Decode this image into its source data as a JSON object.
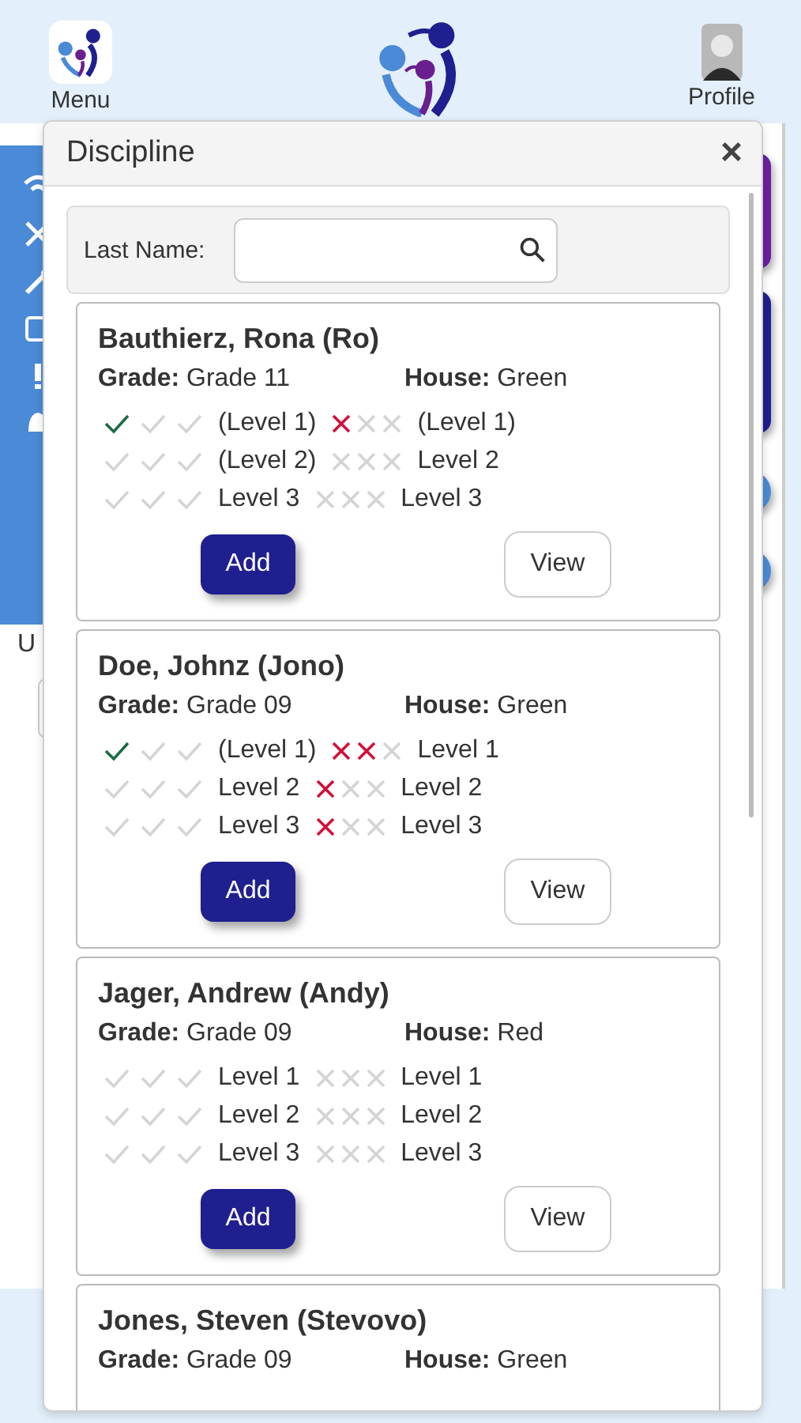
{
  "header": {
    "menu_label": "Menu",
    "profile_label": "Profile"
  },
  "background": {
    "sidebar_letter": "U"
  },
  "dialog": {
    "title": "Discipline",
    "close": "×",
    "search": {
      "label": "Last Name:"
    },
    "students": [
      {
        "name": "Bauthierz, Rona (Ro)",
        "grade_label": "Grade:",
        "grade": "Grade 11",
        "house_label": "House:",
        "house": "Green",
        "add": "Add",
        "view": "View",
        "rows": [
          {
            "ticks": [
              {
                "on": true
              },
              {
                "on": false
              },
              {
                "on": false
              }
            ],
            "merit": "(Level 1)",
            "crosses": [
              {
                "on": true
              },
              {
                "on": false
              },
              {
                "on": false
              }
            ],
            "demerit": "(Level 1)"
          },
          {
            "ticks": [
              {
                "on": false
              },
              {
                "on": false
              },
              {
                "on": false
              }
            ],
            "merit": "(Level 2)",
            "crosses": [
              {
                "on": false
              },
              {
                "on": false
              },
              {
                "on": false
              }
            ],
            "demerit": "Level 2"
          },
          {
            "ticks": [
              {
                "on": false
              },
              {
                "on": false
              },
              {
                "on": false
              }
            ],
            "merit": "Level 3",
            "crosses": [
              {
                "on": false
              },
              {
                "on": false
              },
              {
                "on": false
              }
            ],
            "demerit": "Level 3"
          }
        ]
      },
      {
        "name": "Doe, Johnz (Jono)",
        "grade_label": "Grade:",
        "grade": "Grade 09",
        "house_label": "House:",
        "house": "Green",
        "add": "Add",
        "view": "View",
        "rows": [
          {
            "ticks": [
              {
                "on": true
              },
              {
                "on": false
              },
              {
                "on": false
              }
            ],
            "merit": "(Level 1)",
            "crosses": [
              {
                "on": true
              },
              {
                "on": true
              },
              {
                "on": false
              }
            ],
            "demerit": "Level 1"
          },
          {
            "ticks": [
              {
                "on": false
              },
              {
                "on": false
              },
              {
                "on": false
              }
            ],
            "merit": "Level 2",
            "crosses": [
              {
                "on": true
              },
              {
                "on": false
              },
              {
                "on": false
              }
            ],
            "demerit": "Level 2"
          },
          {
            "ticks": [
              {
                "on": false
              },
              {
                "on": false
              },
              {
                "on": false
              }
            ],
            "merit": "Level 3",
            "crosses": [
              {
                "on": true
              },
              {
                "on": false
              },
              {
                "on": false
              }
            ],
            "demerit": "Level 3"
          }
        ]
      },
      {
        "name": "Jager, Andrew (Andy)",
        "grade_label": "Grade:",
        "grade": "Grade 09",
        "house_label": "House:",
        "house": "Red",
        "add": "Add",
        "view": "View",
        "rows": [
          {
            "ticks": [
              {
                "on": false
              },
              {
                "on": false
              },
              {
                "on": false
              }
            ],
            "merit": "Level 1",
            "crosses": [
              {
                "on": false
              },
              {
                "on": false
              },
              {
                "on": false
              }
            ],
            "demerit": "Level 1"
          },
          {
            "ticks": [
              {
                "on": false
              },
              {
                "on": false
              },
              {
                "on": false
              }
            ],
            "merit": "Level 2",
            "crosses": [
              {
                "on": false
              },
              {
                "on": false
              },
              {
                "on": false
              }
            ],
            "demerit": "Level 2"
          },
          {
            "ticks": [
              {
                "on": false
              },
              {
                "on": false
              },
              {
                "on": false
              }
            ],
            "merit": "Level 3",
            "crosses": [
              {
                "on": false
              },
              {
                "on": false
              },
              {
                "on": false
              }
            ],
            "demerit": "Level 3"
          }
        ]
      },
      {
        "name": "Jones, Steven (Stevovo)",
        "grade_label": "Grade:",
        "grade": "Grade 09",
        "house_label": "House:",
        "house": "Green"
      }
    ]
  }
}
